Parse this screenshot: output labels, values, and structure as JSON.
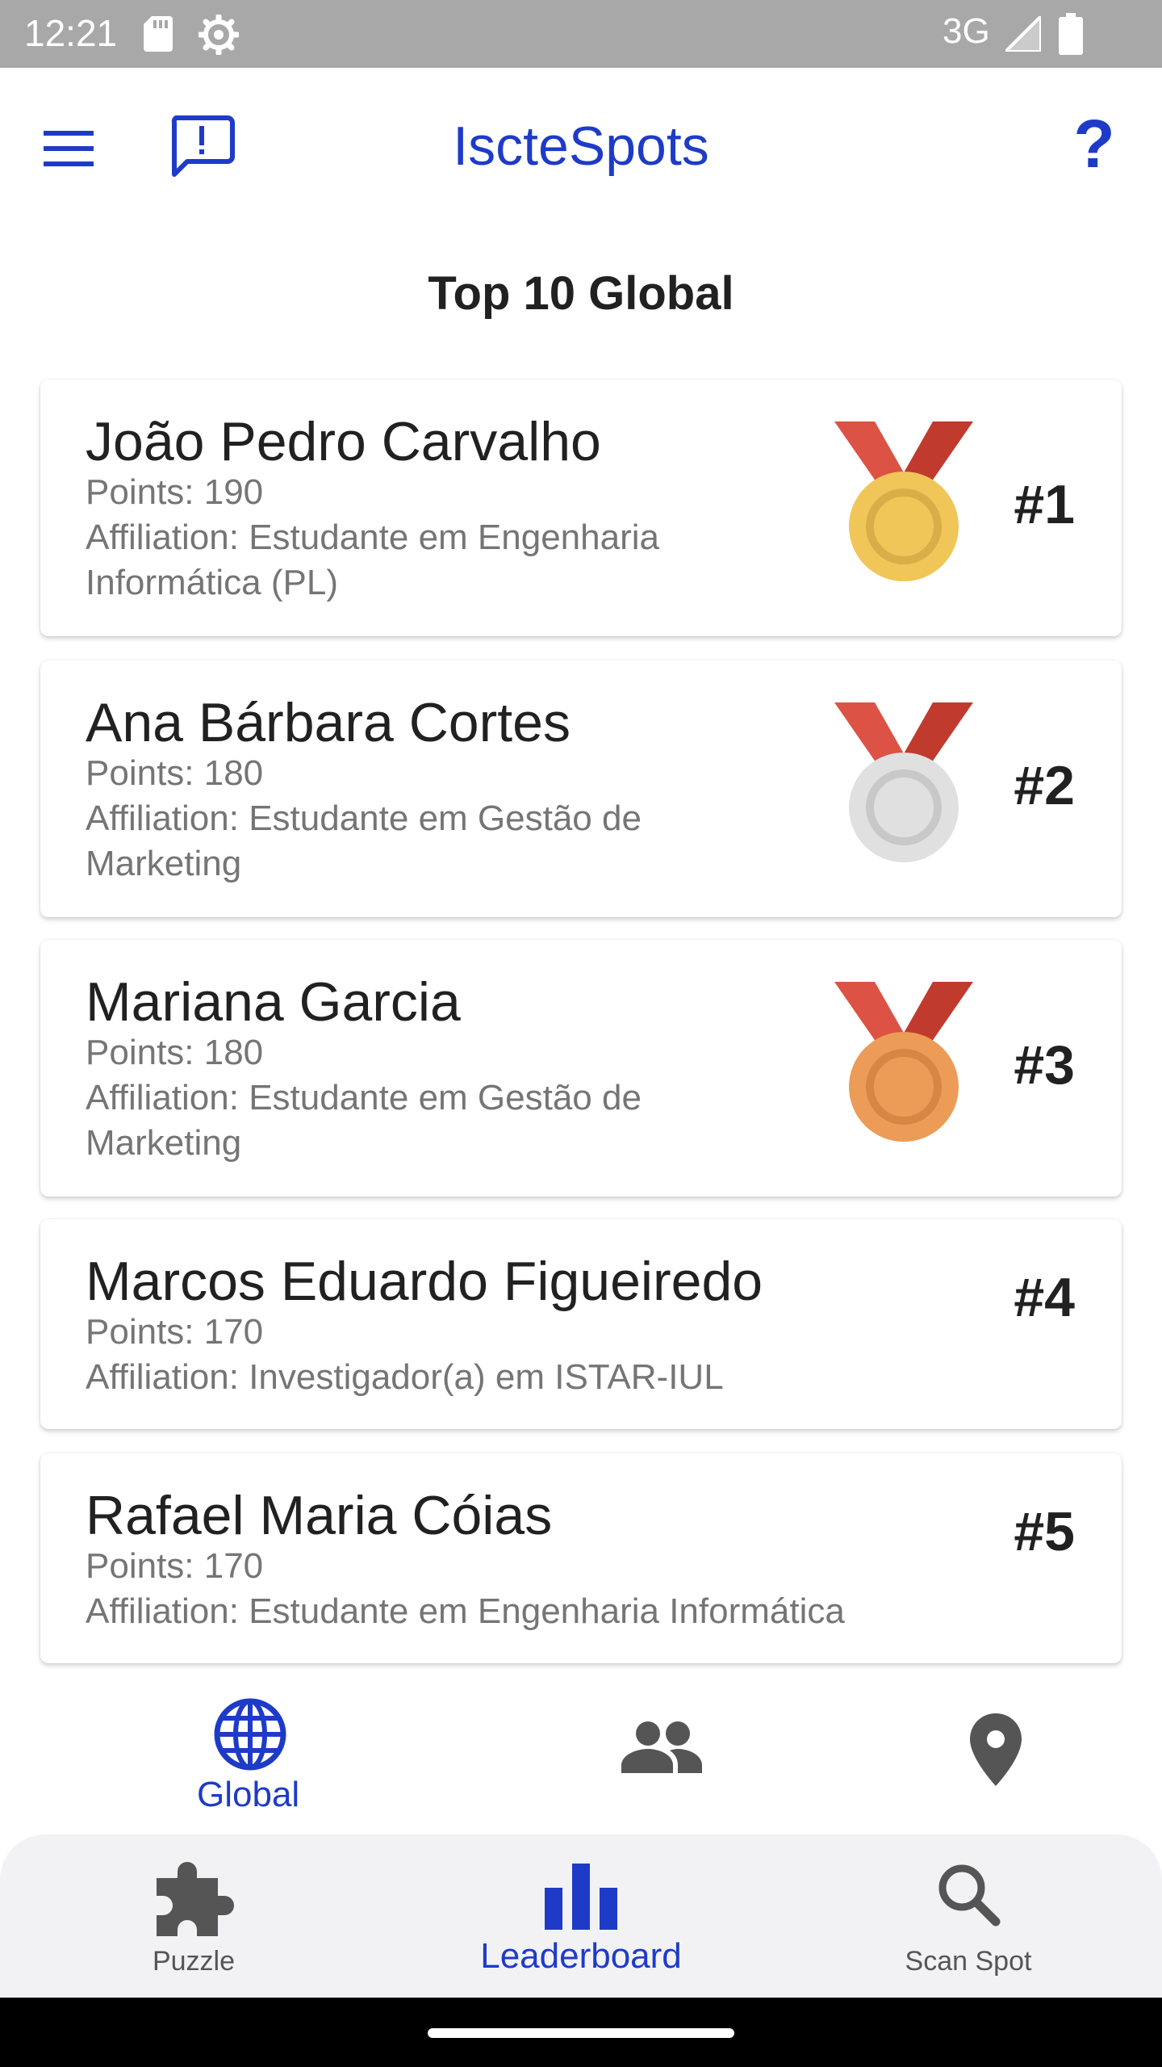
{
  "status_bar": {
    "time": "12:21",
    "network": "3G",
    "icons": [
      "sd-card-icon",
      "gear-icon",
      "signal-icon",
      "battery-icon"
    ]
  },
  "app_bar": {
    "title": "IscteSpots",
    "help_label": "?",
    "icons": [
      "menu-icon",
      "feedback-icon"
    ],
    "accent_color": "#1e3bc8"
  },
  "leaderboard": {
    "title": "Top 10 Global",
    "entries": [
      {
        "name": "João Pedro Carvalho",
        "points": "Points: 190",
        "affiliation": "Affiliation: Estudante em Engenharia Informática (PL)",
        "rank": "#1",
        "medal": "gold-medal-icon",
        "medal_color": "#f0c659"
      },
      {
        "name": "Ana Bárbara Cortes",
        "points": "Points: 180",
        "affiliation": "Affiliation: Estudante em Gestão de Marketing",
        "rank": "#2",
        "medal": "silver-medal-icon",
        "medal_color": "#e0e0e0"
      },
      {
        "name": "Mariana Garcia",
        "points": "Points: 180",
        "affiliation": "Affiliation: Estudante em Gestão de Marketing",
        "rank": "#3",
        "medal": "bronze-medal-icon",
        "medal_color": "#ec9c57"
      },
      {
        "name": "Marcos Eduardo Figueiredo",
        "points": "Points: 170",
        "affiliation": "Affiliation: Investigador(a) em ISTAR-IUL",
        "rank": "#4"
      },
      {
        "name": "Rafael Maria Cóias",
        "points": "Points: 170",
        "affiliation": "Affiliation: Estudante em Engenharia Informática",
        "rank": "#5"
      }
    ]
  },
  "sub_tabs": {
    "active": "Global",
    "items": [
      {
        "label": "Global",
        "icon": "globe-icon"
      },
      {
        "label": "",
        "icon": "people-icon"
      },
      {
        "label": "",
        "icon": "location-pin-icon"
      }
    ]
  },
  "bottom_nav": {
    "active": "Leaderboard",
    "items": [
      {
        "label": "Puzzle",
        "icon": "puzzle-icon"
      },
      {
        "label": "Leaderboard",
        "icon": "bar-chart-icon"
      },
      {
        "label": "Scan Spot",
        "icon": "search-icon"
      }
    ]
  }
}
